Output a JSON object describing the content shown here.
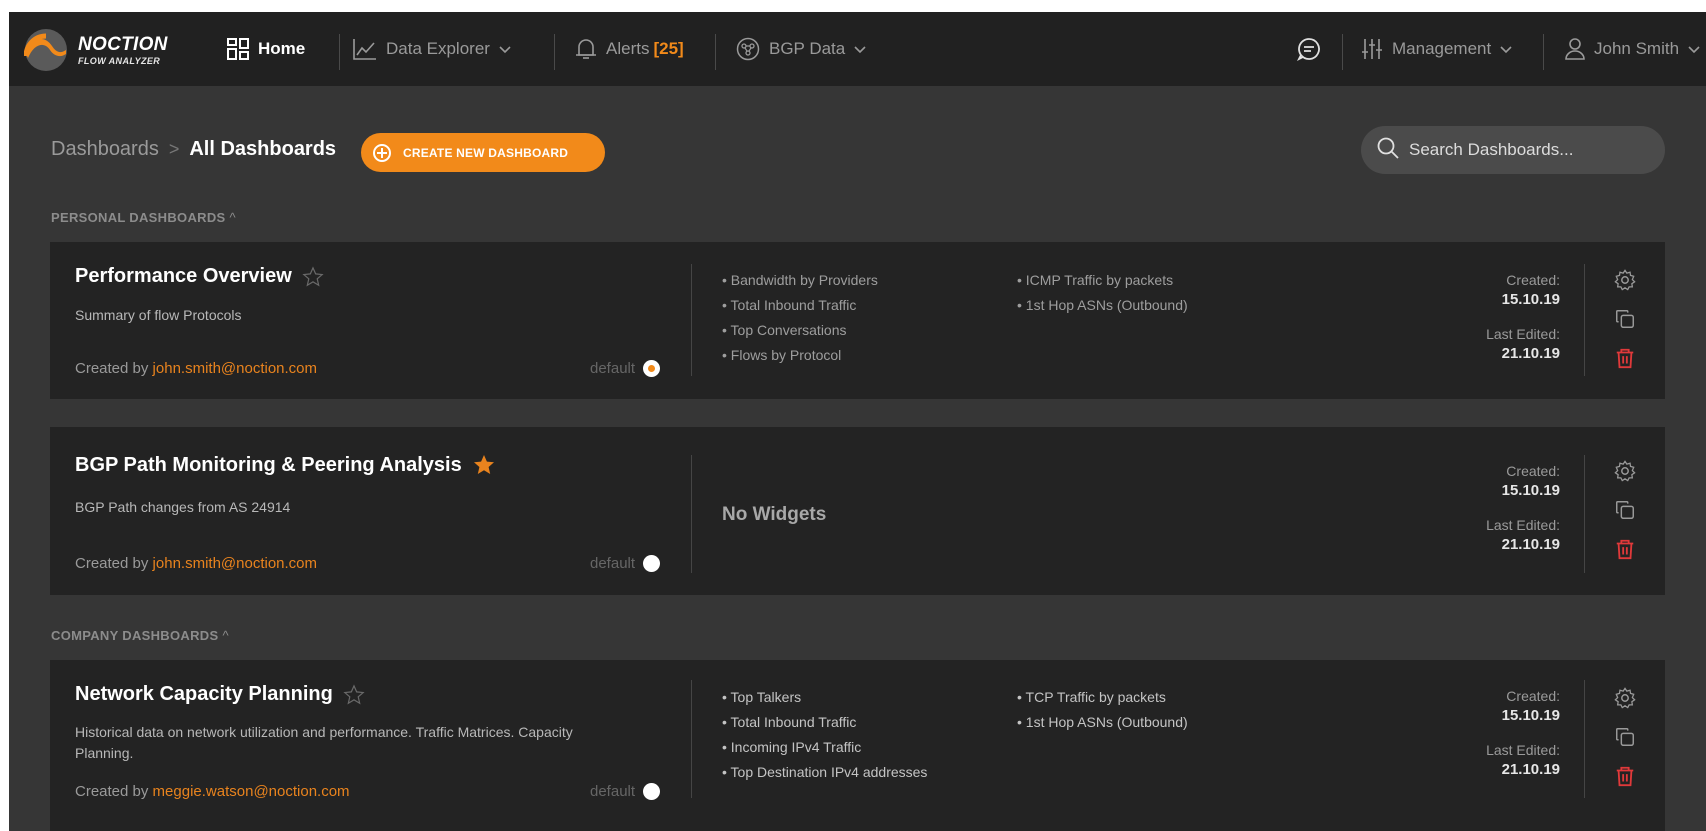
{
  "brand": {
    "name": "NOCTION",
    "product": "FLOW ANALYZER"
  },
  "nav": {
    "home": "Home",
    "data_explorer": "Data Explorer",
    "alerts": "Alerts",
    "alerts_count": "[25]",
    "bgp_data": "BGP Data",
    "management": "Management",
    "user": "John Smith"
  },
  "breadcrumb": {
    "root": "Dashboards",
    "separator": ">",
    "current": "All Dashboards"
  },
  "create_button": "CREATE NEW DASHBOARD",
  "search": {
    "placeholder": "Search Dashboards..."
  },
  "sections": {
    "personal": "PERSONAL DASHBOARDS",
    "company": "COMPANY DASHBOARDS"
  },
  "labels": {
    "created_by": "Created by",
    "default": "default",
    "created": "Created:",
    "last_edited": "Last Edited:",
    "no_widgets": "No Widgets"
  },
  "dashboards": [
    {
      "title": "Performance Overview",
      "favorite": false,
      "description": "Summary of flow Protocols",
      "owner": "john.smith@noction.com",
      "is_default": true,
      "widgets_col1": [
        "Bandwidth by Providers",
        "Total Inbound Traffic",
        "Top Conversations",
        "Flows by Protocol"
      ],
      "widgets_col2": [
        "ICMP Traffic by packets",
        "1st Hop ASNs (Outbound)"
      ],
      "created": "15.10.19",
      "last_edited": "21.10.19"
    },
    {
      "title": "BGP Path Monitoring & Peering Analysis",
      "favorite": true,
      "description": "BGP Path changes from AS 24914",
      "owner": "john.smith@noction.com",
      "is_default": false,
      "widgets_col1": [],
      "widgets_col2": [],
      "created": "15.10.19",
      "last_edited": "21.10.19"
    },
    {
      "title": "Network Capacity Planning",
      "favorite": false,
      "description": "Historical data on network utilization and performance. Traffic Matrices. Capacity Planning.",
      "owner": "meggie.watson@noction.com",
      "is_default": false,
      "widgets_col1": [
        "Top Talkers",
        "Total Inbound Traffic",
        "Incoming IPv4 Traffic",
        "Top Destination IPv4 addresses"
      ],
      "widgets_col2": [
        "TCP Traffic by packets",
        "1st Hop ASNs (Outbound)"
      ],
      "created": "15.10.19",
      "last_edited": "21.10.19"
    }
  ],
  "colors": {
    "accent": "#f28a1a",
    "danger": "#e0393a",
    "topbar": "#212121",
    "page": "#363636",
    "card": "#232323"
  },
  "icons": [
    "home-grid-icon",
    "chart-line-icon",
    "bell-icon",
    "bgp-network-icon",
    "chat-icon",
    "sliders-icon",
    "user-icon",
    "search-icon",
    "star-icon",
    "gear-icon",
    "copy-icon",
    "trash-icon",
    "chevron-down-icon"
  ]
}
